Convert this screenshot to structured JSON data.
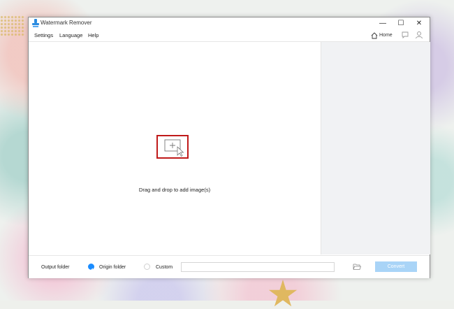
{
  "window": {
    "title": "Watermark Remover",
    "controls": {
      "minimize": "—",
      "maximize": "☐",
      "close": "✕"
    }
  },
  "menu": {
    "items": [
      "Settings",
      "Language",
      "Help"
    ],
    "home_label": "Home"
  },
  "main": {
    "drop_label": "Drag and drop to add image(s)",
    "add_icon": "add-image-icon"
  },
  "footer": {
    "output_folder_label": "Output folder",
    "origin_folder_label": "Origin folder",
    "custom_label": "Custom",
    "custom_path_value": "",
    "convert_label": "Convert",
    "selected_option": "Origin folder"
  },
  "colors": {
    "accent": "#1a8cff",
    "convert_disabled": "#a9d4f7",
    "highlight_box": "#c01a1a",
    "side_panel": "#f1f2f4"
  }
}
